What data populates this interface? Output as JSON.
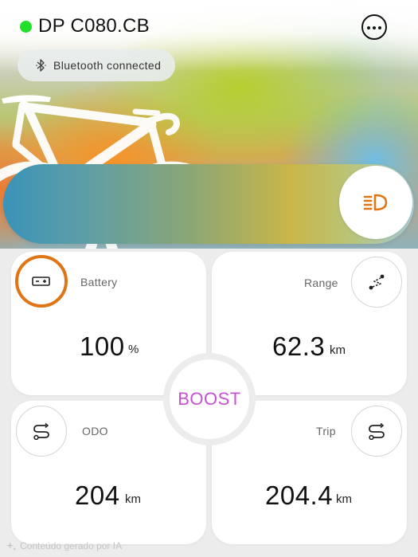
{
  "header": {
    "device_name": "DP C080.CB",
    "connection_status_color": "#22e02a",
    "bluetooth_label": "Bluetooth connected",
    "more_icon": "more-horizontal-icon"
  },
  "light": {
    "icon": "headlight-icon",
    "accent": "#e07516"
  },
  "cards": {
    "battery": {
      "label": "Battery",
      "value": "100",
      "unit": "%",
      "icon": "battery-icon"
    },
    "range": {
      "label": "Range",
      "value": "62.3",
      "unit": "km",
      "icon": "route-icon"
    },
    "odo": {
      "label": "ODO",
      "value": "204",
      "unit": "km",
      "icon": "path-icon"
    },
    "trip": {
      "label": "Trip",
      "value": "204.4",
      "unit": "km",
      "icon": "path-icon"
    }
  },
  "boost": {
    "label": "BOOST",
    "color": "#c84fd8"
  },
  "watermark": {
    "text": "Conteúdo gerado por IA"
  }
}
